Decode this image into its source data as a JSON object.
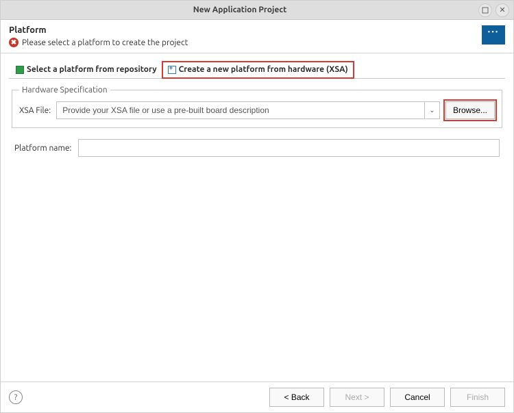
{
  "window": {
    "title": "New Application Project"
  },
  "header": {
    "title": "Platform",
    "message": "Please select a platform to create the project"
  },
  "tabs": [
    {
      "label": "Select a platform from repository"
    },
    {
      "label": "Create a new platform from hardware (XSA)"
    }
  ],
  "hardware_spec": {
    "legend": "Hardware Specification",
    "xsa_label": "XSA File:",
    "xsa_placeholder": "Provide your XSA file or use a pre-built board description",
    "xsa_value": "",
    "browse_label": "Browse..."
  },
  "platform": {
    "name_label": "Platform name:",
    "name_value": ""
  },
  "footer": {
    "back": "< Back",
    "next": "Next >",
    "cancel": "Cancel",
    "finish": "Finish"
  }
}
